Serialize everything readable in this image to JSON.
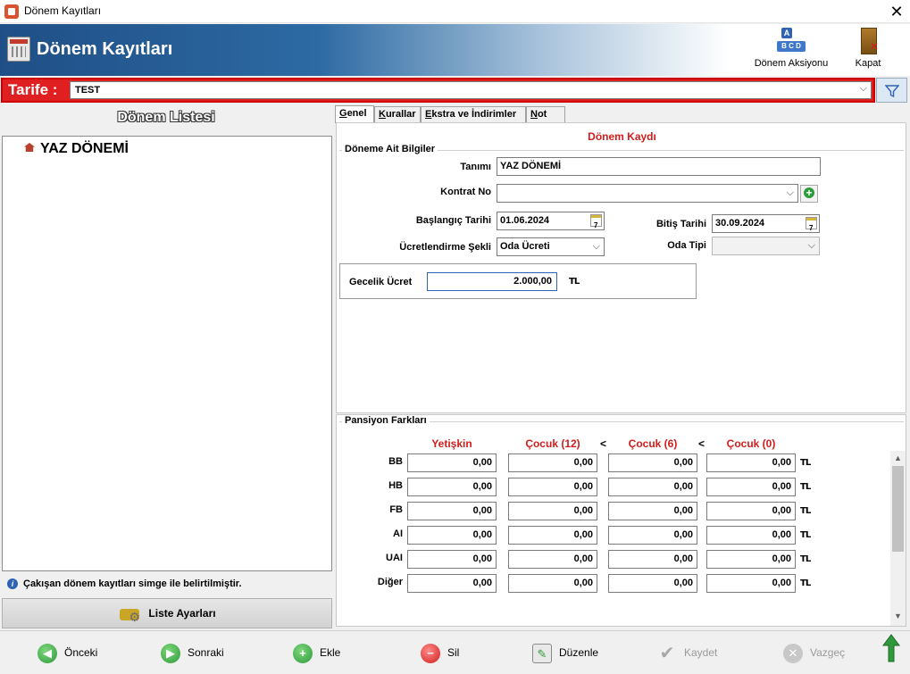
{
  "window": {
    "title": "Dönem Kayıtları",
    "close_glyph": "✕"
  },
  "header": {
    "title": "Dönem Kayıtları",
    "action_label": "Dönem Aksiyonu",
    "close_label": "Kapat"
  },
  "tarife": {
    "label": "Tarife :",
    "value": "TEST"
  },
  "left": {
    "title": "Dönem Listesi",
    "items": [
      "YAZ DÖNEMİ"
    ],
    "info": "Çakışan dönem kayıtları simge ile belirtilmiştir.",
    "settings_button": "Liste Ayarları"
  },
  "tabs": [
    {
      "pre": "",
      "key": "G",
      "rest": "enel"
    },
    {
      "pre": "",
      "key": "K",
      "rest": "urallar"
    },
    {
      "pre": "",
      "key": "E",
      "rest": "kstra ve İndirimler"
    },
    {
      "pre": "",
      "key": "N",
      "rest": "ot"
    }
  ],
  "form": {
    "section_title": "Dönem Kaydı",
    "group_title": "Döneme Ait Bilgiler",
    "tanimi_label": "Tanımı",
    "tanimi_value": "YAZ DÖNEMİ",
    "kontrat_label": "Kontrat No",
    "kontrat_value": "",
    "baslangic_label": "Başlangıç Tarihi",
    "baslangic_value": "01.06.2024",
    "bitis_label": "Bitiş Tarihi",
    "bitis_value": "30.09.2024",
    "ucret_label": "Ücretlendirme Şekli",
    "ucret_value": "Oda Ücreti",
    "oda_tipi_label": "Oda Tipi",
    "oda_tipi_value": "",
    "gecelik_label": "Gecelik Ücret",
    "gecelik_value": "2.000,00",
    "currency": "TL"
  },
  "pansiyon": {
    "title": "Pansiyon Farkları",
    "columns": [
      "Yetişkin",
      "Çocuk (12)",
      "Çocuk (6)",
      "Çocuk (0)"
    ],
    "lt": "<",
    "rows": [
      {
        "label": "BB",
        "values": [
          "0,00",
          "0,00",
          "0,00",
          "0,00"
        ]
      },
      {
        "label": "HB",
        "values": [
          "0,00",
          "0,00",
          "0,00",
          "0,00"
        ]
      },
      {
        "label": "FB",
        "values": [
          "0,00",
          "0,00",
          "0,00",
          "0,00"
        ]
      },
      {
        "label": "AI",
        "values": [
          "0,00",
          "0,00",
          "0,00",
          "0,00"
        ]
      },
      {
        "label": "UAI",
        "values": [
          "0,00",
          "0,00",
          "0,00",
          "0,00"
        ]
      },
      {
        "label": "Diğer",
        "values": [
          "0,00",
          "0,00",
          "0,00",
          "0,00"
        ]
      }
    ]
  },
  "bottom": {
    "prev": "Önceki",
    "next": "Sonraki",
    "add": "Ekle",
    "delete": "Sil",
    "edit": "Düzenle",
    "save": "Kaydet",
    "cancel": "Vazgeç"
  },
  "colors": {
    "accent_red": "#d01c1c",
    "header_blue": "#1f4f86",
    "green": "#2e9a3c"
  }
}
